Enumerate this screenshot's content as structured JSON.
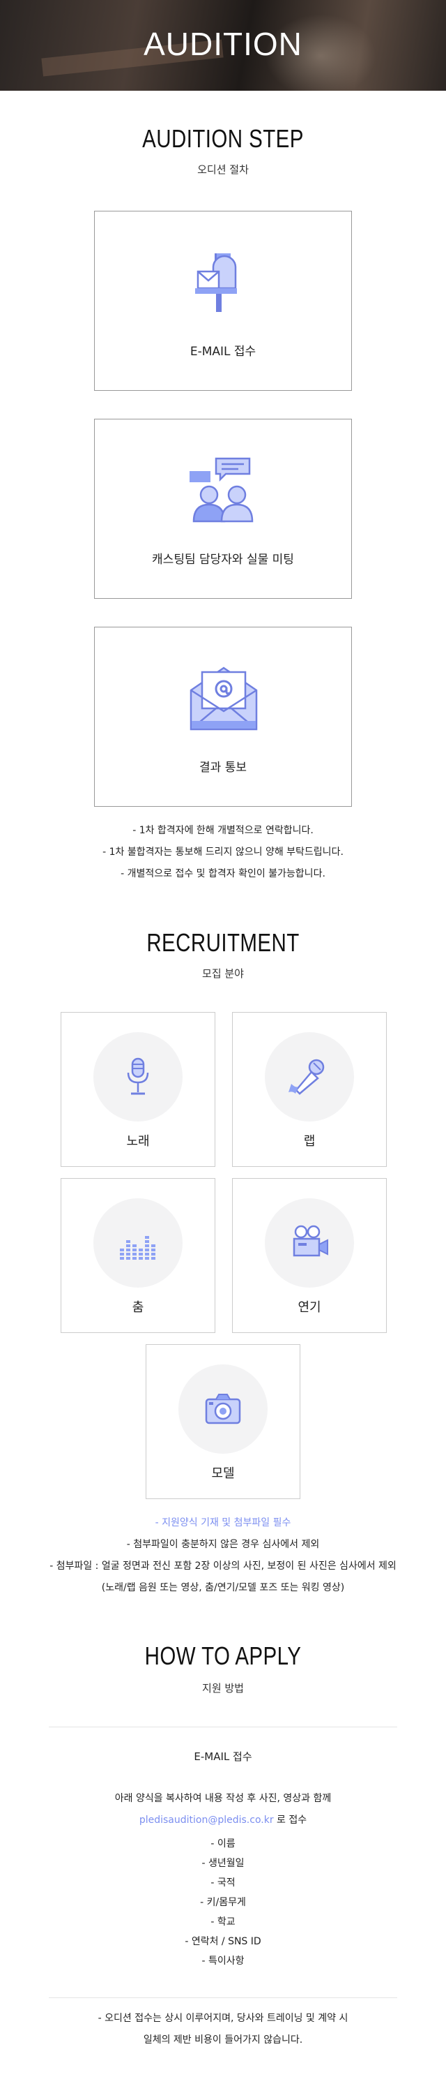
{
  "hero": {
    "title": "AUDITION"
  },
  "step": {
    "title": "AUDITION STEP",
    "subtitle": "오디션 절차",
    "items": [
      {
        "label": "E-MAIL 접수",
        "icon": "mailbox-icon"
      },
      {
        "label": "캐스팅팀 담당자와 실물 미팅",
        "icon": "meeting-icon"
      },
      {
        "label": "결과 통보",
        "icon": "envelope-at-icon"
      }
    ],
    "notes": [
      "- 1차 합격자에 한해 개별적으로 연락합니다.",
      "- 1차 불합격자는 통보해 드리지 않으니 양해 부탁드립니다.",
      "- 개별적으로 접수 및 합격자 확인이 불가능합니다."
    ]
  },
  "recruit": {
    "title": "RECRUITMENT",
    "subtitle": "모집 분야",
    "items": [
      {
        "label": "노래",
        "icon": "microphone-stand-icon"
      },
      {
        "label": "랩",
        "icon": "handheld-microphone-icon"
      },
      {
        "label": "춤",
        "icon": "equalizer-icon"
      },
      {
        "label": "연기",
        "icon": "video-camera-icon"
      },
      {
        "label": "모델",
        "icon": "camera-icon"
      }
    ],
    "requirement": "- 지원양식 기재 및 첨부파일 필수",
    "notes": [
      "- 첨부파일이 충분하지 않은 경우 심사에서 제외",
      "- 첨부파일 : 얼굴 정면과 전신 포함 2장 이상의 사진, 보정이 된 사진은 심사에서 제외",
      "(노래/랩 음원 또는 영상, 춤/연기/모델 포즈 또는 워킹 영상)"
    ]
  },
  "apply": {
    "title": "HOW TO APPLY",
    "subtitle": "지원 방법",
    "method": "E-MAIL 접수",
    "instruction": "아래 양식을 복사하여 내용 작성 후 사진, 영상과 함께",
    "email": "pledisaudition@pledis.co.kr",
    "email_suffix": " 로 접수",
    "form_fields": [
      "- 이름",
      "- 생년월일",
      "- 국적",
      "- 키/몸무게",
      "- 학교",
      "- 연락처 / SNS ID",
      "- 특이사항"
    ],
    "footer": [
      "- 오디션 접수는 상시 이루어지며, 당사와 트레이닝 및 계약 시",
      "일체의 제반 비용이 들어가지 않습니다."
    ]
  },
  "colors": {
    "accent": "#7b8ef0",
    "icon_blue": "#8ea2f5",
    "icon_dark": "#6f7fe0",
    "border": "#999999",
    "circle_bg": "#f3f3f4"
  }
}
